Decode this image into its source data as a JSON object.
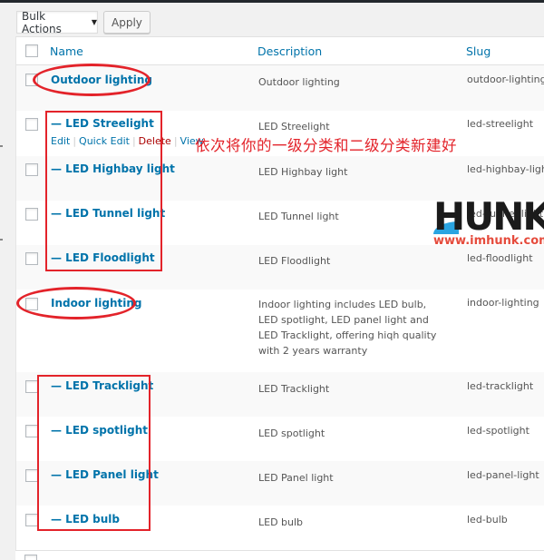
{
  "toolbar": {
    "bulk_actions_label": "Bulk Actions",
    "apply_label": "Apply"
  },
  "table": {
    "columns": {
      "name": "Name",
      "description": "Description",
      "slug": "Slug"
    },
    "rows": [
      {
        "name": "Outdoor lighting",
        "description": "Outdoor lighting",
        "slug": "outdoor-lighting",
        "level": 0
      },
      {
        "name": "— LED Streelight",
        "description": "LED Streelight",
        "slug": "led-streelight",
        "level": 1
      },
      {
        "name": "— LED Highbay light",
        "description": "LED Highbay light",
        "slug": "led-highbay-light",
        "level": 1
      },
      {
        "name": "— LED Tunnel light",
        "description": "LED Tunnel light",
        "slug": "led-tunnel-light",
        "level": 1
      },
      {
        "name": "— LED Floodlight",
        "description": "LED Floodlight",
        "slug": "led-floodlight",
        "level": 1
      },
      {
        "name": "Indoor lighting",
        "description": "Indoor lighting includes LED bulb, LED spotlight, LED panel light and LED Tracklight, offering hiqh quality with 2 years warranty",
        "slug": "indoor-lighting",
        "level": 0
      },
      {
        "name": "— LED Tracklight",
        "description": "LED Tracklight",
        "slug": "led-tracklight",
        "level": 1
      },
      {
        "name": "— LED spotlight",
        "description": "LED spotlight",
        "slug": "led-spotlight",
        "level": 1
      },
      {
        "name": "— LED Panel light",
        "description": "LED Panel light",
        "slug": "led-panel-light",
        "level": 1
      },
      {
        "name": "— LED bulb",
        "description": "LED bulb",
        "slug": "led-bulb",
        "level": 1
      }
    ],
    "row_actions": {
      "edit": "Edit",
      "quick_edit": "Quick Edit",
      "delete": "Delete",
      "view": "View"
    }
  },
  "annotation": {
    "text": "依次将你的一级分类和二级分类新建好",
    "color": "#e3232a"
  },
  "watermark": {
    "brand": "HUNK",
    "url": "www.imhunk.com"
  },
  "colors": {
    "link": "#0073aa",
    "delete": "#aa0000"
  }
}
